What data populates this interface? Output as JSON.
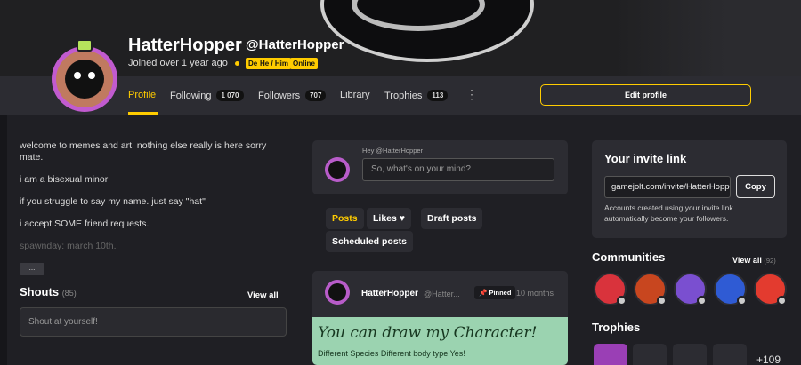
{
  "profile": {
    "username": "HatterHopper",
    "handle": "@HatterHopper",
    "joined": "Joined over 1 year ago",
    "tags": [
      "Dev",
      "He / Him",
      "Online"
    ]
  },
  "nav": {
    "profile": "Profile",
    "following": "Following",
    "following_count": "1 070",
    "followers": "Followers",
    "followers_count": "707",
    "library": "Library",
    "trophies": "Trophies",
    "trophies_count": "113",
    "kebab": "⋮",
    "edit_profile": "Edit profile"
  },
  "bio": {
    "lines": [
      "welcome to memes and art. nothing else really is here sorry mate.",
      "i am a bisexual minor",
      "if you struggle to say my name. just say \"hat\"",
      "i accept SOME friend requests.",
      "spawnday: march 10th."
    ],
    "more": "..."
  },
  "shouts": {
    "title": "Shouts",
    "count": "(85)",
    "view_all": "View all",
    "placeholder": "Shout at yourself!"
  },
  "composer": {
    "hey": "Hey @HatterHopper",
    "placeholder": "So, what's on your mind?"
  },
  "post_tabs": [
    "Posts",
    "Likes",
    "Draft posts",
    "Scheduled posts"
  ],
  "post": {
    "user": "HatterHopper",
    "handle": "@Hatter...",
    "pinned": "Pinned",
    "time": "10 months",
    "drawing_line1": "You can draw my Character!",
    "drawing_line2": "Different Species   Different body type   Yes!"
  },
  "invite": {
    "title": "Your invite link",
    "link": "gamejolt.com/invite/HatterHopper",
    "copy": "Copy",
    "note": "Accounts created using your invite link automatically become your followers."
  },
  "communities": {
    "title": "Communities",
    "view_all": "View all",
    "count": "(92)",
    "colors": [
      "#d9333c",
      "#c8461f",
      "#7a4fd0",
      "#2f5bd4",
      "#e33b2f"
    ]
  },
  "trophies": {
    "title": "Trophies",
    "more": "+109",
    "colors": [
      "#9a3fb5",
      "#2c2c32",
      "#2c2c32",
      "#2c2c32"
    ]
  },
  "colors": {
    "accent": "#ffcc00",
    "card": "#2c2c32",
    "background": "#1f1f24"
  }
}
